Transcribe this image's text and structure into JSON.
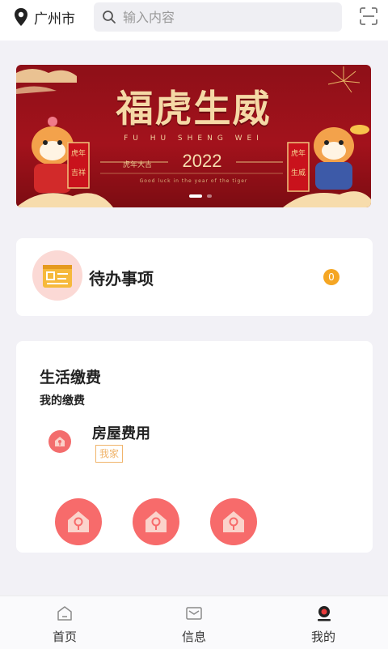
{
  "header": {
    "location_label": "广州市",
    "search_placeholder": "输入内容"
  },
  "banner": {
    "title": "福虎生威",
    "subtitle": "FU HU SHENG WEI",
    "year": "2022",
    "left_text": "虎年大吉",
    "tagline": "Good luck in the year of the tiger",
    "active_slide": 1,
    "slide_count": 2
  },
  "todo": {
    "label": "待办事项",
    "count": "0"
  },
  "payment": {
    "title": "生活缴费",
    "subtitle": "我的缴费",
    "fee": {
      "title": "房屋费用",
      "tag": "我家"
    },
    "house_count": 3
  },
  "nav": {
    "items": [
      {
        "label": "首页",
        "icon": "home-icon"
      },
      {
        "label": "信息",
        "icon": "mail-icon"
      },
      {
        "label": "我的",
        "icon": "profile-icon",
        "active": true
      }
    ]
  },
  "colors": {
    "accent_red": "#f76b6b",
    "badge_orange": "#f5a623",
    "tag_orange": "#f0b46b",
    "banner_red": "#a3121c"
  }
}
